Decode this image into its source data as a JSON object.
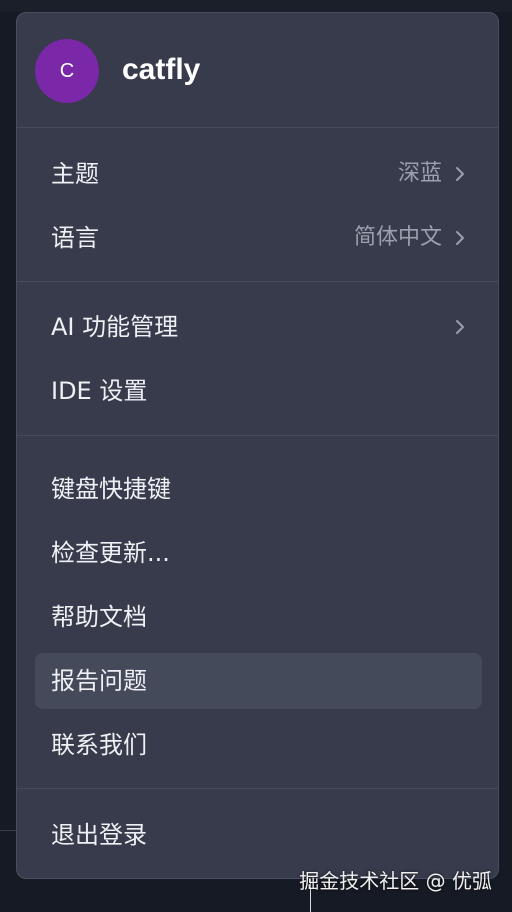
{
  "user": {
    "avatar_letter": "C",
    "name": "catfly",
    "avatar_color": "#7a27a8"
  },
  "menu": {
    "groups": [
      {
        "items": [
          {
            "label": "主题",
            "value": "深蓝",
            "has_submenu": true
          },
          {
            "label": "语言",
            "value": "简体中文",
            "has_submenu": true
          }
        ]
      },
      {
        "items": [
          {
            "label": "AI 功能管理",
            "has_submenu": true
          },
          {
            "label": "IDE 设置"
          }
        ]
      },
      {
        "items": [
          {
            "label": "键盘快捷键"
          },
          {
            "label": "检查更新..."
          },
          {
            "label": "帮助文档"
          },
          {
            "label": "报告问题",
            "highlighted": true
          },
          {
            "label": "联系我们"
          }
        ]
      },
      {
        "items": [
          {
            "label": "退出登录"
          }
        ]
      }
    ]
  },
  "watermark": "掘金技术社区 @ 优弧",
  "colors": {
    "menu_background": "#373b4b",
    "hover_background": "#454a5a",
    "text": "#eef0f4",
    "secondary_text": "#9aa0ad"
  }
}
